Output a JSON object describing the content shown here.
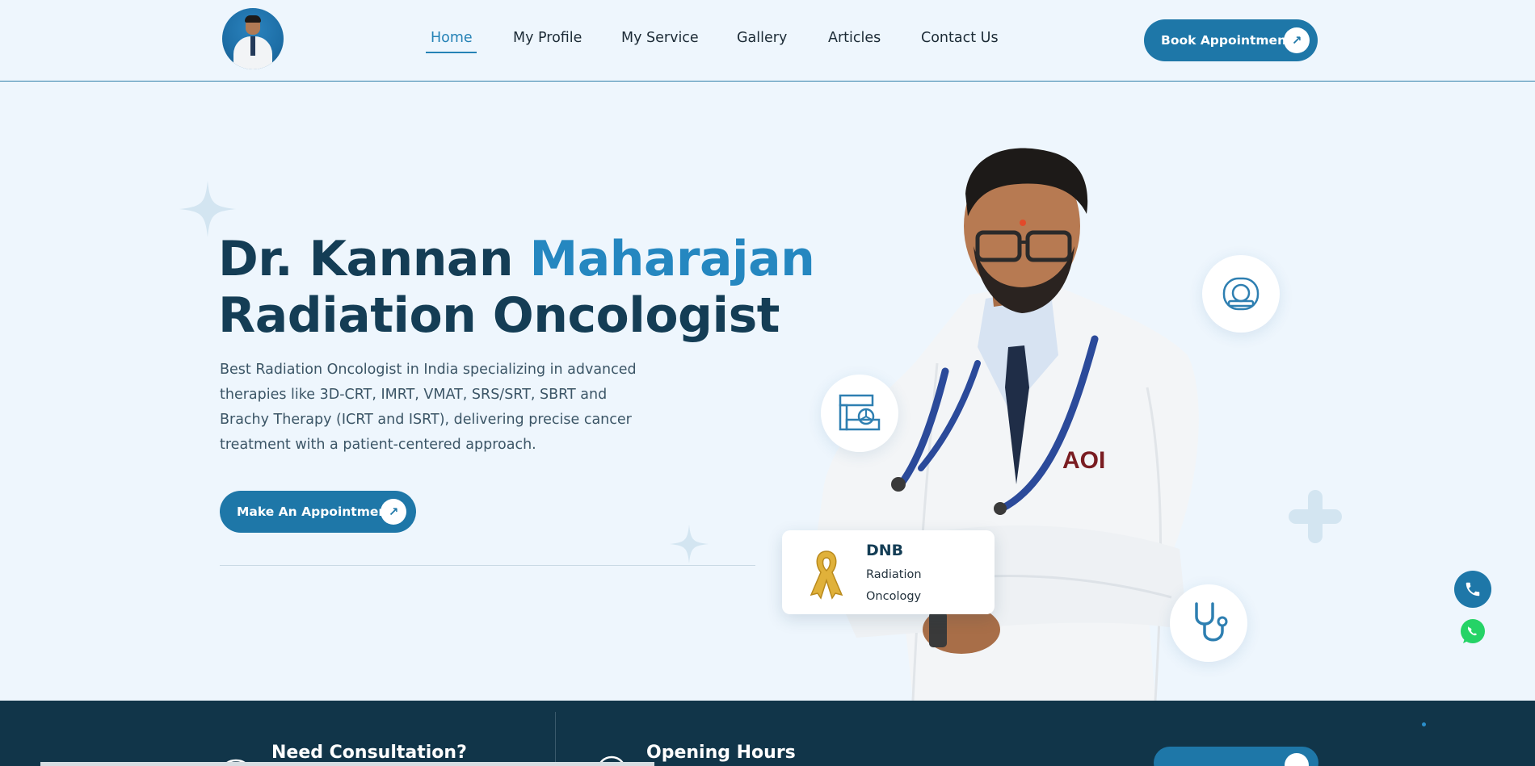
{
  "nav": {
    "items": [
      {
        "label": "Home",
        "active": true
      },
      {
        "label": "My Profile"
      },
      {
        "label": "My Service"
      },
      {
        "label": "Gallery"
      },
      {
        "label": "Articles"
      },
      {
        "label": "Contact Us"
      }
    ],
    "cta_label": "Book Appointment",
    "cta_icon": "arrow-up-right-icon"
  },
  "hero": {
    "title_first": "Dr. Kannan ",
    "title_accent": "Maharajan",
    "title_second": "Radiation Oncologist",
    "description": "Best Radiation Oncologist in India specializing in advanced therapies like 3D-CRT, IMRT, VMAT, SRS/SRT, SBRT and Brachy Therapy (ICRT and ISRT), delivering precise cancer treatment with a patient-centered approach.",
    "cta_label": "Make An Appointment"
  },
  "credential": {
    "title": "DNB",
    "subtitle_line1": "Radiation",
    "subtitle_line2": "Oncology",
    "icon": "gold-ribbon-icon"
  },
  "badges": {
    "coat_logo": "AOI"
  },
  "bottom": {
    "consultation_title": "Need Consultation?",
    "hours_title": "Opening Hours"
  },
  "colors": {
    "primary": "#1e77a8",
    "accent": "#2587c0",
    "heading": "#143d55",
    "background": "#eef6fd",
    "footer": "#113549",
    "whatsapp": "#25d366"
  }
}
